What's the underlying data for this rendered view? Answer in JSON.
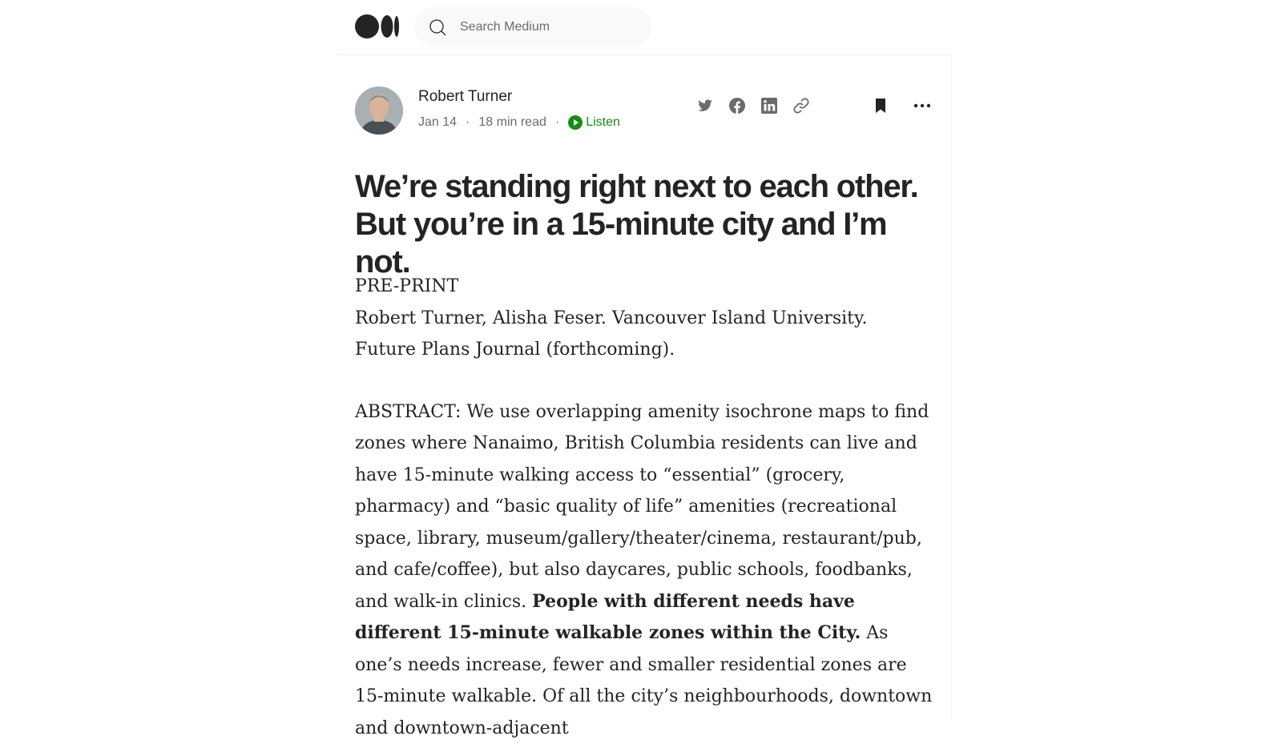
{
  "search": {
    "placeholder": "Search Medium"
  },
  "author": {
    "name": "Robert Turner",
    "date": "Jan 14",
    "read_time": "18 min read",
    "listen_label": "Listen"
  },
  "share_icons": [
    "twitter-icon",
    "facebook-icon",
    "linkedin-icon",
    "link-icon"
  ],
  "article": {
    "title_line1": "We’re standing right next to each other.",
    "title_line2": "But you’re in a 15-minute city and I’m not.",
    "preprint": "PRE-PRINT",
    "citation": "Robert Turner, Alisha Feser. Vancouver Island University. Future Plans Journal (forthcoming).",
    "abstract_intro": "ABSTRACT: We use overlapping amenity isochrone maps to find zones where Nanaimo, British Columbia residents can live and have 15-minute walking access to “essential” (grocery, pharmacy) and “basic quality of life” amenities (recreational space, library, museum/gallery/theater/cinema, restaurant/pub, and cafe/coffee), but also daycares, public schools, foodbanks, and walk-in clinics.",
    "abstract_bold": "People with different needs have different 15-minute walkable zones within the City.",
    "abstract_rest": "As one’s needs increase, fewer and smaller residential zones are 15-minute walkable. Of all the city’s neighbourhoods, downtown and downtown-adjacent"
  },
  "colors": {
    "accent_green": "#1a8917",
    "text": "#242424",
    "muted": "#6b6b6b"
  }
}
